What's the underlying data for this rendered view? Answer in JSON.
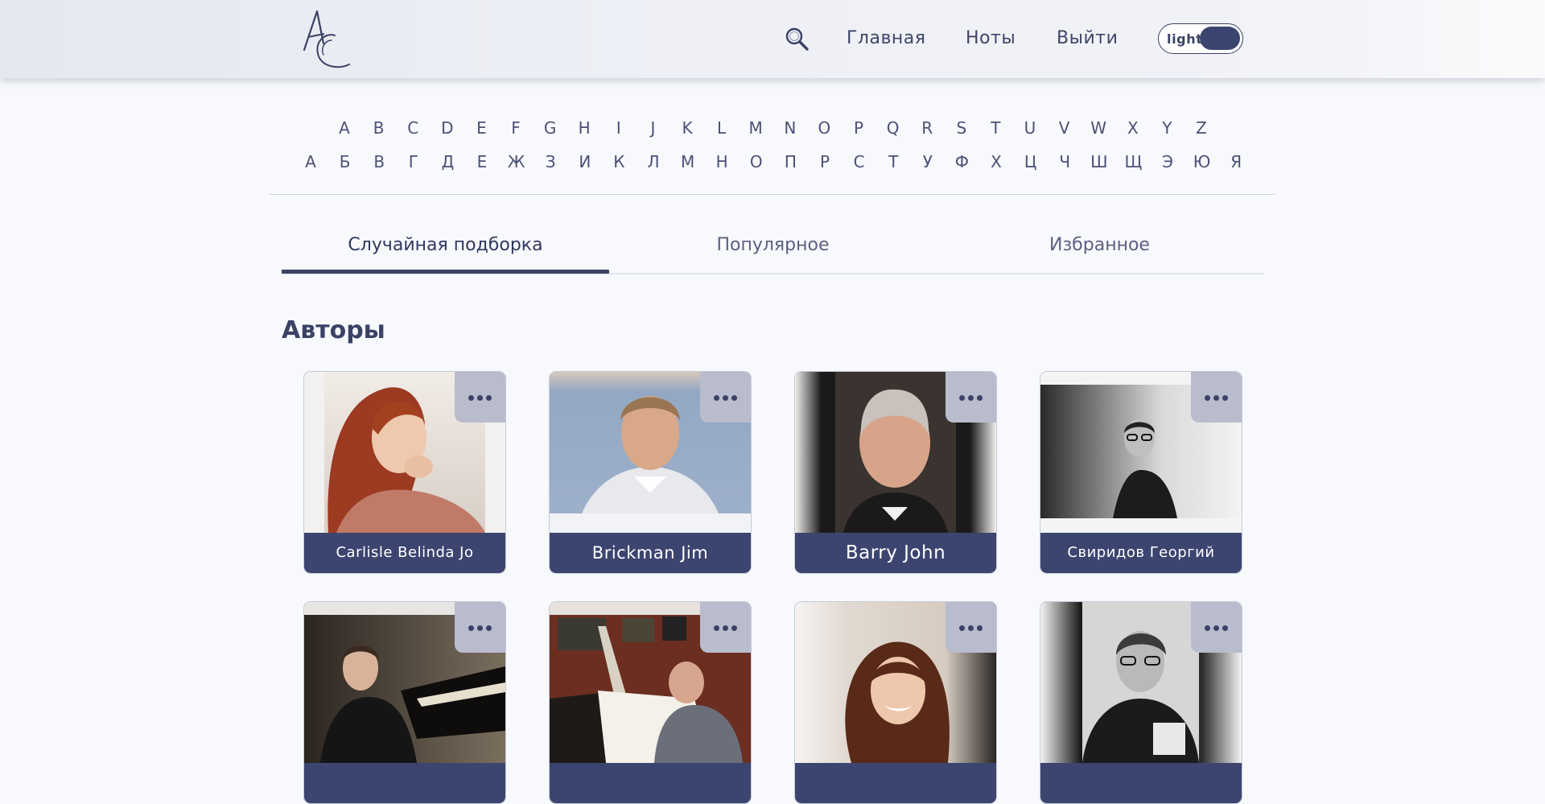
{
  "header": {
    "logo_text": "AC",
    "nav": {
      "home": "Главная",
      "notes": "Ноты",
      "logout": "Выйти"
    },
    "theme_toggle": {
      "label": "light"
    },
    "icons": {
      "search": "search-icon",
      "logo": "logo-icon"
    }
  },
  "alphabet": {
    "latin": [
      "A",
      "B",
      "C",
      "D",
      "E",
      "F",
      "G",
      "H",
      "I",
      "J",
      "K",
      "L",
      "M",
      "N",
      "O",
      "P",
      "Q",
      "R",
      "S",
      "T",
      "U",
      "V",
      "W",
      "X",
      "Y",
      "Z"
    ],
    "cyrillic": [
      "А",
      "Б",
      "В",
      "Г",
      "Д",
      "Е",
      "Ж",
      "З",
      "И",
      "К",
      "Л",
      "М",
      "Н",
      "О",
      "П",
      "Р",
      "С",
      "Т",
      "У",
      "Ф",
      "Х",
      "Ц",
      "Ч",
      "Ш",
      "Щ",
      "Э",
      "Ю",
      "Я"
    ]
  },
  "tabs": [
    {
      "label": "Случайная подборка",
      "active": true
    },
    {
      "label": "Популярное",
      "active": false
    },
    {
      "label": "Избранное",
      "active": false
    }
  ],
  "section": {
    "title": "Авторы"
  },
  "authors": [
    {
      "name": "Carlisle Belinda Jo"
    },
    {
      "name": "Brickman Jim"
    },
    {
      "name": "Barry John"
    },
    {
      "name": "Свиридов Георгий"
    },
    {
      "name": ""
    },
    {
      "name": ""
    },
    {
      "name": ""
    },
    {
      "name": ""
    }
  ],
  "colors": {
    "accent": "#3a4266",
    "card_label_bg": "#3c4570",
    "card_menu_bg": "#b9bccd",
    "page_bg": "#f8f9fd"
  }
}
